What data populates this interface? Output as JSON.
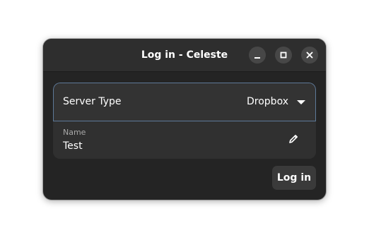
{
  "window": {
    "title": "Log in - Celeste",
    "controls": {
      "minimize_icon": "minimize-icon",
      "maximize_icon": "maximize-icon",
      "close_icon": "close-icon"
    }
  },
  "form": {
    "server_type": {
      "label": "Server Type",
      "selected": "Dropbox",
      "icon": "chevron-down-icon"
    },
    "name": {
      "caption": "Name",
      "value": "Test",
      "icon": "edit-icon"
    },
    "login_label": "Log in"
  },
  "colors": {
    "window_bg": "#242424",
    "titlebar_bg": "#2e2e2e",
    "row_bg": "#303030",
    "focus_border": "#5e7a99",
    "button_bg": "#3a3a3a"
  }
}
